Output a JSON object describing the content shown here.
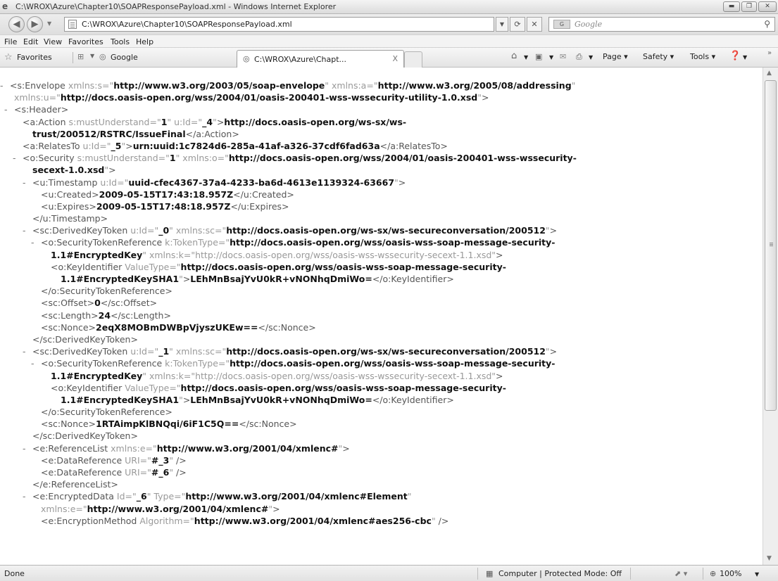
{
  "window": {
    "title": "C:\\WROX\\Azure\\Chapter10\\SOAPResponsePayload.xml - Windows Internet Explorer",
    "controls": [
      "minimize",
      "maximize",
      "close"
    ]
  },
  "address_bar": {
    "url": "C:\\WROX\\Azure\\Chapter10\\SOAPResponsePayload.xml",
    "search_placeholder": "Google"
  },
  "menu": [
    "File",
    "Edit",
    "View",
    "Favorites",
    "Tools",
    "Help"
  ],
  "favorites_bar": {
    "favorites_label": "Favorites",
    "google_label": "Google",
    "tab_title": "C:\\WROX\\Azure\\Chapt...",
    "tab_close": "X",
    "commands": {
      "page": "Page",
      "safety": "Safety",
      "tools": "Tools"
    },
    "chevron": "»"
  },
  "xml_lines": [
    {
      "indent": 0,
      "toggle": "-",
      "parts": [
        [
          "tg",
          "<s:Envelope "
        ],
        [
          "at",
          "xmlns:s=\""
        ],
        [
          "v",
          "http://www.w3.org/2003/05/soap-envelope"
        ],
        [
          "at",
          "\" xmlns:a=\""
        ],
        [
          "v",
          "http://www.w3.org/2005/08/addressing"
        ],
        [
          "at",
          "\""
        ]
      ]
    },
    {
      "indent": 1,
      "toggle": "",
      "parts": [
        [
          "at",
          "xmlns:u=\""
        ],
        [
          "v",
          "http://docs.oasis-open.org/wss/2004/01/oasis-200401-wss-wssecurity-utility-1.0.xsd"
        ],
        [
          "at",
          "\""
        ],
        [
          "tg",
          ">"
        ]
      ]
    },
    {
      "indent": 1,
      "toggle": "-",
      "parts": [
        [
          "tg",
          "<s:Header>"
        ]
      ]
    },
    {
      "indent": 2,
      "toggle": "",
      "parts": [
        [
          "tg",
          "<a:Action "
        ],
        [
          "at",
          "s:mustUnderstand=\""
        ],
        [
          "v",
          "1"
        ],
        [
          "at",
          "\" u:Id=\""
        ],
        [
          "v",
          "_4"
        ],
        [
          "at",
          "\""
        ],
        [
          "tg",
          ">"
        ],
        [
          "v",
          "http://docs.oasis-open.org/ws-sx/ws-"
        ]
      ]
    },
    {
      "indent": 3,
      "toggle": "",
      "parts": [
        [
          "v",
          "trust/200512/RSTRC/IssueFinal"
        ],
        [
          "tg",
          "</a:Action>"
        ]
      ]
    },
    {
      "indent": 2,
      "toggle": "",
      "parts": [
        [
          "tg",
          "<a:RelatesTo "
        ],
        [
          "at",
          "u:Id=\""
        ],
        [
          "v",
          "_5"
        ],
        [
          "at",
          "\""
        ],
        [
          "tg",
          ">"
        ],
        [
          "v",
          "urn:uuid:1c7824d6-285a-41af-a326-37cdf6fad63a"
        ],
        [
          "tg",
          "</a:RelatesTo>"
        ]
      ]
    },
    {
      "indent": 2,
      "toggle": "-",
      "parts": [
        [
          "tg",
          "<o:Security "
        ],
        [
          "at",
          "s:mustUnderstand=\""
        ],
        [
          "v",
          "1"
        ],
        [
          "at",
          "\" xmlns:o=\""
        ],
        [
          "v",
          "http://docs.oasis-open.org/wss/2004/01/oasis-200401-wss-wssecurity-"
        ]
      ]
    },
    {
      "indent": 3,
      "toggle": "",
      "parts": [
        [
          "v",
          "secext-1.0.xsd"
        ],
        [
          "at",
          "\""
        ],
        [
          "tg",
          ">"
        ]
      ]
    },
    {
      "indent": 3,
      "toggle": "-",
      "parts": [
        [
          "tg",
          "<u:Timestamp "
        ],
        [
          "at",
          "u:Id=\""
        ],
        [
          "v",
          "uuid-cfec4367-37a4-4233-ba6d-4613e1139324-63667"
        ],
        [
          "at",
          "\""
        ],
        [
          "tg",
          ">"
        ]
      ]
    },
    {
      "indent": 4,
      "toggle": "",
      "parts": [
        [
          "tg",
          "<u:Created>"
        ],
        [
          "v",
          "2009-05-15T17:43:18.957Z"
        ],
        [
          "tg",
          "</u:Created>"
        ]
      ]
    },
    {
      "indent": 4,
      "toggle": "",
      "parts": [
        [
          "tg",
          "<u:Expires>"
        ],
        [
          "v",
          "2009-05-15T17:48:18.957Z"
        ],
        [
          "tg",
          "</u:Expires>"
        ]
      ]
    },
    {
      "indent": 3,
      "toggle": "",
      "parts": [
        [
          "tg",
          "</u:Timestamp>"
        ]
      ]
    },
    {
      "indent": 3,
      "toggle": "-",
      "parts": [
        [
          "tg",
          "<sc:DerivedKeyToken "
        ],
        [
          "at",
          "u:Id=\""
        ],
        [
          "v",
          "_0"
        ],
        [
          "at",
          "\" xmlns:sc=\""
        ],
        [
          "v",
          "http://docs.oasis-open.org/ws-sx/ws-secureconversation/200512"
        ],
        [
          "at",
          "\""
        ],
        [
          "tg",
          ">"
        ]
      ]
    },
    {
      "indent": 4,
      "toggle": "-",
      "parts": [
        [
          "tg",
          "<o:SecurityTokenReference "
        ],
        [
          "at",
          "k:TokenType=\""
        ],
        [
          "v",
          "http://docs.oasis-open.org/wss/oasis-wss-soap-message-security-"
        ]
      ]
    },
    {
      "indent": 5,
      "toggle": "",
      "parts": [
        [
          "v",
          "1.1#EncryptedKey"
        ],
        [
          "at",
          "\" xmlns:k=\""
        ],
        [
          "at",
          "http://docs.oasis-open.org/wss/oasis-wss-wssecurity-secext-1.1.xsd"
        ],
        [
          "at",
          "\""
        ],
        [
          "tg",
          ">"
        ]
      ]
    },
    {
      "indent": 5,
      "toggle": "",
      "parts": [
        [
          "tg",
          "<o:KeyIdentifier "
        ],
        [
          "at",
          "ValueType=\""
        ],
        [
          "v",
          "http://docs.oasis-open.org/wss/oasis-wss-soap-message-security-"
        ]
      ]
    },
    {
      "indent": 6,
      "toggle": "",
      "parts": [
        [
          "v",
          "1.1#EncryptedKeySHA1"
        ],
        [
          "at",
          "\""
        ],
        [
          "tg",
          ">"
        ],
        [
          "v",
          "LEhMnBsajYvU0kR+vNONhqDmiWo="
        ],
        [
          "tg",
          "</o:KeyIdentifier>"
        ]
      ]
    },
    {
      "indent": 4,
      "toggle": "",
      "parts": [
        [
          "tg",
          "</o:SecurityTokenReference>"
        ]
      ]
    },
    {
      "indent": 4,
      "toggle": "",
      "parts": [
        [
          "tg",
          "<sc:Offset>"
        ],
        [
          "v",
          "0"
        ],
        [
          "tg",
          "</sc:Offset>"
        ]
      ]
    },
    {
      "indent": 4,
      "toggle": "",
      "parts": [
        [
          "tg",
          "<sc:Length>"
        ],
        [
          "v",
          "24"
        ],
        [
          "tg",
          "</sc:Length>"
        ]
      ]
    },
    {
      "indent": 4,
      "toggle": "",
      "parts": [
        [
          "tg",
          "<sc:Nonce>"
        ],
        [
          "v",
          "2eqX8MOBmDWBpVjyszUKEw=="
        ],
        [
          "tg",
          "</sc:Nonce>"
        ]
      ]
    },
    {
      "indent": 3,
      "toggle": "",
      "parts": [
        [
          "tg",
          "</sc:DerivedKeyToken>"
        ]
      ]
    },
    {
      "indent": 3,
      "toggle": "-",
      "parts": [
        [
          "tg",
          "<sc:DerivedKeyToken "
        ],
        [
          "at",
          "u:Id=\""
        ],
        [
          "v",
          "_1"
        ],
        [
          "at",
          "\" xmlns:sc=\""
        ],
        [
          "v",
          "http://docs.oasis-open.org/ws-sx/ws-secureconversation/200512"
        ],
        [
          "at",
          "\""
        ],
        [
          "tg",
          ">"
        ]
      ]
    },
    {
      "indent": 4,
      "toggle": "-",
      "parts": [
        [
          "tg",
          "<o:SecurityTokenReference "
        ],
        [
          "at",
          "k:TokenType=\""
        ],
        [
          "v",
          "http://docs.oasis-open.org/wss/oasis-wss-soap-message-security-"
        ]
      ]
    },
    {
      "indent": 5,
      "toggle": "",
      "parts": [
        [
          "v",
          "1.1#EncryptedKey"
        ],
        [
          "at",
          "\" xmlns:k=\""
        ],
        [
          "at",
          "http://docs.oasis-open.org/wss/oasis-wss-wssecurity-secext-1.1.xsd"
        ],
        [
          "at",
          "\""
        ],
        [
          "tg",
          ">"
        ]
      ]
    },
    {
      "indent": 5,
      "toggle": "",
      "parts": [
        [
          "tg",
          "<o:KeyIdentifier "
        ],
        [
          "at",
          "ValueType=\""
        ],
        [
          "v",
          "http://docs.oasis-open.org/wss/oasis-wss-soap-message-security-"
        ]
      ]
    },
    {
      "indent": 6,
      "toggle": "",
      "parts": [
        [
          "v",
          "1.1#EncryptedKeySHA1"
        ],
        [
          "at",
          "\""
        ],
        [
          "tg",
          ">"
        ],
        [
          "v",
          "LEhMnBsajYvU0kR+vNONhqDmiWo="
        ],
        [
          "tg",
          "</o:KeyIdentifier>"
        ]
      ]
    },
    {
      "indent": 4,
      "toggle": "",
      "parts": [
        [
          "tg",
          "</o:SecurityTokenReference>"
        ]
      ]
    },
    {
      "indent": 4,
      "toggle": "",
      "parts": [
        [
          "tg",
          "<sc:Nonce>"
        ],
        [
          "v",
          "1RTAimpKlBNQqi/6iF1C5Q=="
        ],
        [
          "tg",
          "</sc:Nonce>"
        ]
      ]
    },
    {
      "indent": 3,
      "toggle": "",
      "parts": [
        [
          "tg",
          "</sc:DerivedKeyToken>"
        ]
      ]
    },
    {
      "indent": 3,
      "toggle": "-",
      "parts": [
        [
          "tg",
          "<e:ReferenceList "
        ],
        [
          "at",
          "xmlns:e=\""
        ],
        [
          "v",
          "http://www.w3.org/2001/04/xmlenc#"
        ],
        [
          "at",
          "\""
        ],
        [
          "tg",
          ">"
        ]
      ]
    },
    {
      "indent": 4,
      "toggle": "",
      "parts": [
        [
          "tg",
          "<e:DataReference "
        ],
        [
          "at",
          "URI=\""
        ],
        [
          "v",
          "#_3"
        ],
        [
          "at",
          "\""
        ],
        [
          "tg",
          " />"
        ]
      ]
    },
    {
      "indent": 4,
      "toggle": "",
      "parts": [
        [
          "tg",
          "<e:DataReference "
        ],
        [
          "at",
          "URI=\""
        ],
        [
          "v",
          "#_6"
        ],
        [
          "at",
          "\""
        ],
        [
          "tg",
          " />"
        ]
      ]
    },
    {
      "indent": 3,
      "toggle": "",
      "parts": [
        [
          "tg",
          "</e:ReferenceList>"
        ]
      ]
    },
    {
      "indent": 3,
      "toggle": "-",
      "parts": [
        [
          "tg",
          "<e:EncryptedData "
        ],
        [
          "at",
          "Id=\""
        ],
        [
          "v",
          "_6"
        ],
        [
          "at",
          "\" Type=\""
        ],
        [
          "v",
          "http://www.w3.org/2001/04/xmlenc#Element"
        ],
        [
          "at",
          "\""
        ]
      ]
    },
    {
      "indent": 4,
      "toggle": "",
      "parts": [
        [
          "at",
          "xmlns:e=\""
        ],
        [
          "v",
          "http://www.w3.org/2001/04/xmlenc#"
        ],
        [
          "at",
          "\""
        ],
        [
          "tg",
          ">"
        ]
      ]
    },
    {
      "indent": 4,
      "toggle": "",
      "parts": [
        [
          "tg",
          "<e:EncryptionMethod "
        ],
        [
          "at",
          "Algorithm=\""
        ],
        [
          "v",
          "http://www.w3.org/2001/04/xmlenc#aes256-cbc"
        ],
        [
          "at",
          "\""
        ],
        [
          "tg",
          " />"
        ]
      ]
    }
  ],
  "status_bar": {
    "status": "Done",
    "zone": "Computer | Protected Mode: Off",
    "zoom": "100%"
  }
}
